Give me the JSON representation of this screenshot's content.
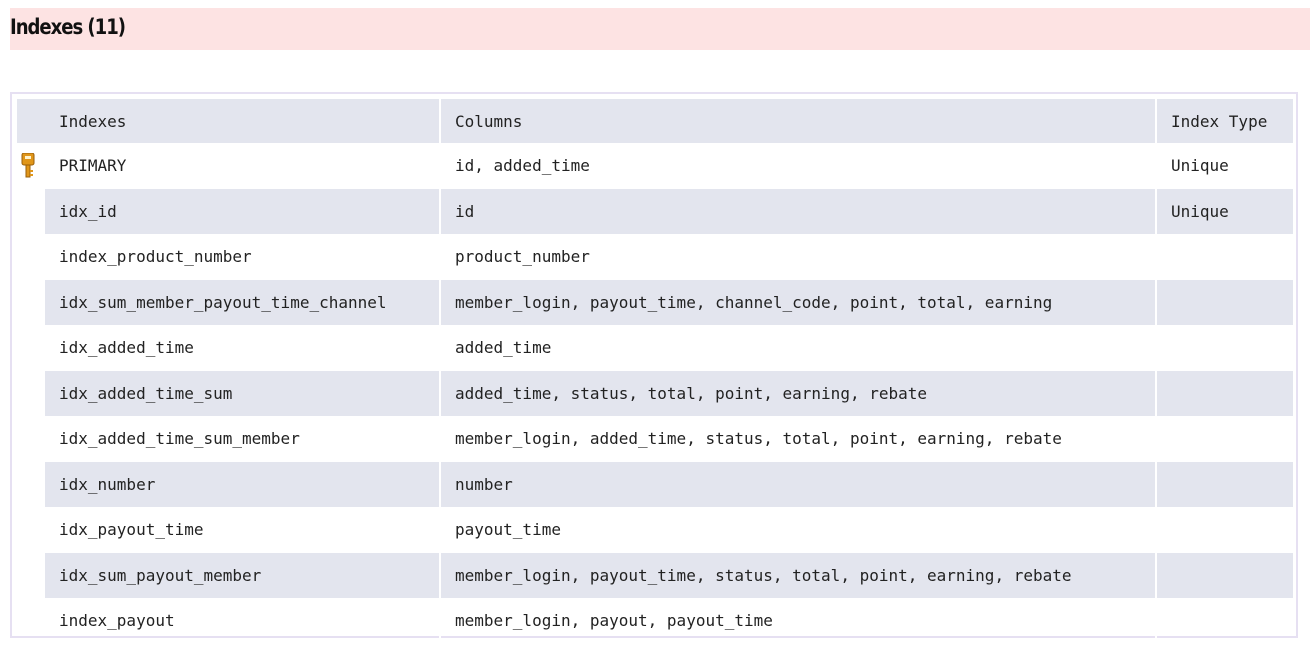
{
  "section": {
    "title": "Indexes (11)"
  },
  "table": {
    "headers": {
      "index": "Indexes",
      "columns": "Columns",
      "type": "Index Type"
    },
    "rows": [
      {
        "index": "PRIMARY",
        "columns": "id, added_time",
        "type": "Unique",
        "icon": "primary-key-icon"
      },
      {
        "index": "idx_id",
        "columns": "id",
        "type": "Unique",
        "icon": ""
      },
      {
        "index": "index_product_number",
        "columns": "product_number",
        "type": "",
        "icon": ""
      },
      {
        "index": "idx_sum_member_payout_time_channel",
        "columns": "member_login, payout_time, channel_code, point, total, earning",
        "type": "",
        "icon": ""
      },
      {
        "index": "idx_added_time",
        "columns": "added_time",
        "type": "",
        "icon": ""
      },
      {
        "index": "idx_added_time_sum",
        "columns": "added_time, status, total, point, earning, rebate",
        "type": "",
        "icon": ""
      },
      {
        "index": "idx_added_time_sum_member",
        "columns": "member_login, added_time, status, total, point, earning, rebate",
        "type": "",
        "icon": ""
      },
      {
        "index": "idx_number",
        "columns": "number",
        "type": "",
        "icon": ""
      },
      {
        "index": "idx_payout_time",
        "columns": "payout_time",
        "type": "",
        "icon": ""
      },
      {
        "index": "idx_sum_payout_member",
        "columns": "member_login, payout_time, status, total, point, earning, rebate",
        "type": "",
        "icon": ""
      },
      {
        "index": "index_payout",
        "columns": "member_login, payout, payout_time",
        "type": "",
        "icon": ""
      }
    ]
  },
  "colors": {
    "header_bg": "#fde3e3",
    "row_alt_bg": "#e3e5ee",
    "border": "#e6e0f2",
    "key_icon": "#e0961a"
  }
}
